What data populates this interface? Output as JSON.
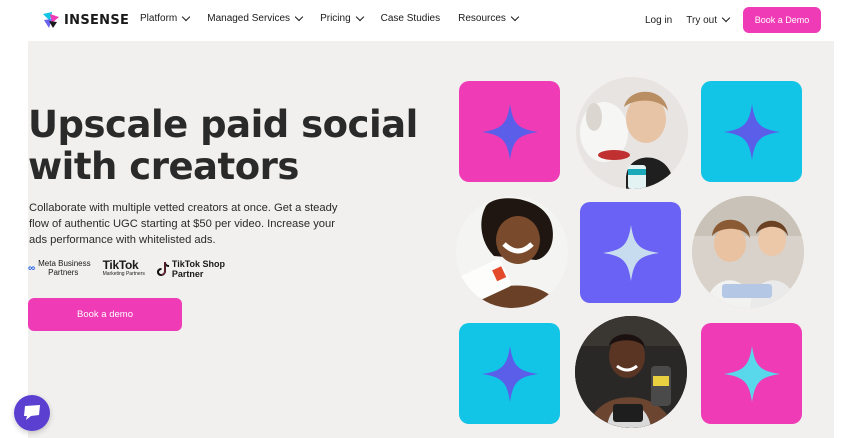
{
  "brand": {
    "name": "INSENSE"
  },
  "nav": {
    "items": [
      {
        "label": "Platform",
        "has_dropdown": true
      },
      {
        "label": "Managed Services",
        "has_dropdown": true
      },
      {
        "label": "Pricing",
        "has_dropdown": true
      },
      {
        "label": "Case Studies",
        "has_dropdown": false
      },
      {
        "label": "Resources",
        "has_dropdown": true
      }
    ],
    "login": "Log in",
    "try_out": "Try out",
    "book_demo": "Book a Demo"
  },
  "hero": {
    "headline_line1": "Upscale paid social",
    "headline_line2": "with creators",
    "subtitle": "Collaborate with multiple vetted creators at once. Get a steady flow of authentic UGC starting at $50 per video. Increase your ads performance with whitelisted ads.",
    "cta": "Book a demo"
  },
  "partners": {
    "meta_line1": "Meta Business",
    "meta_line2": "Partners",
    "tiktok_name": "TikTok",
    "tiktok_sub": "Marketing Partners",
    "tiktok_shop_line1": "TikTok Shop",
    "tiktok_shop_line2": "Partner"
  },
  "colors": {
    "brand_pink": "#f03bb6",
    "tile_cyan": "#12c4e6",
    "tile_indigo": "#6a61f5",
    "star_blue": "#5a5ee8",
    "star_light": "#c8dcef",
    "chat_purple": "#5b3fd1"
  },
  "icons": [
    "chevron-down-icon",
    "sparkle-star-icon",
    "chat-icon",
    "meta-logo-icon",
    "tiktok-logo-icon"
  ]
}
